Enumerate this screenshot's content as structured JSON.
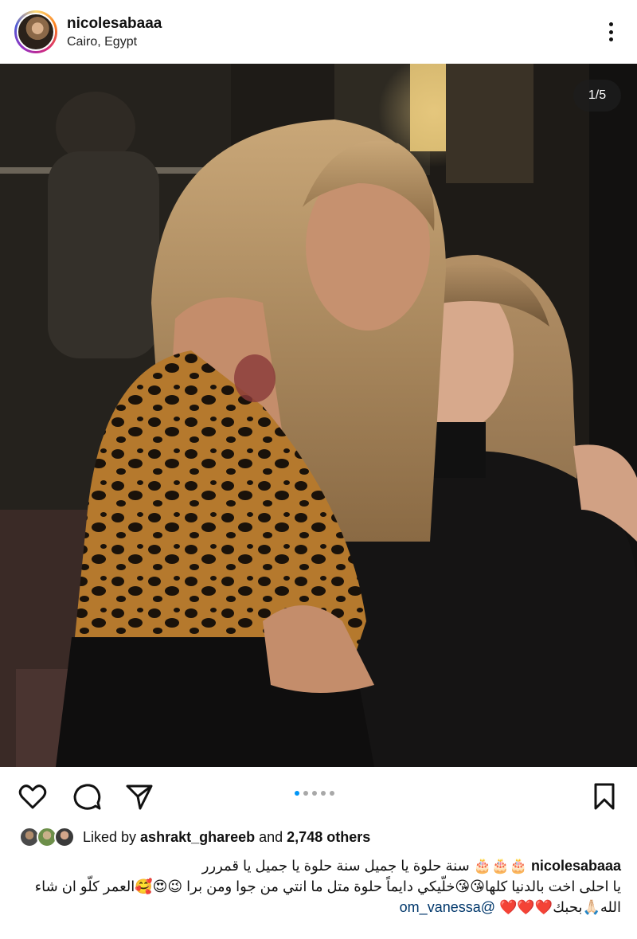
{
  "header": {
    "username": "nicolesabaaa",
    "location": "Cairo, Egypt",
    "more_icon": "more-vertical-icon"
  },
  "post": {
    "counter": "1/5",
    "carousel": {
      "total": 5,
      "active": 1
    }
  },
  "actions": {
    "like_icon": "heart-icon",
    "comment_icon": "comment-icon",
    "share_icon": "send-icon",
    "save_icon": "bookmark-icon"
  },
  "likes": {
    "prefix": "Liked by ",
    "user": "ashrakt_ghareeb",
    "middle": " and ",
    "others": "2,748 others"
  },
  "caption": {
    "username": "nicolesabaaa",
    "line1": "🎂🎂🎂 سنة حلوة يا جميل سنة حلوة يا جميل يا قمررر",
    "line2": "يا احلى اخت بالدنيا كلها😘😘خلّيكي دايماً حلوة متل ما انتي من جوا ومن برا 😉😍🥰العمر كلّو ان شاء الله🙏🏻بحبك❤️❤️❤️ ",
    "mention": "@om_vanessa"
  },
  "colors": {
    "accent": "#0095f6",
    "mention": "#00376b"
  }
}
